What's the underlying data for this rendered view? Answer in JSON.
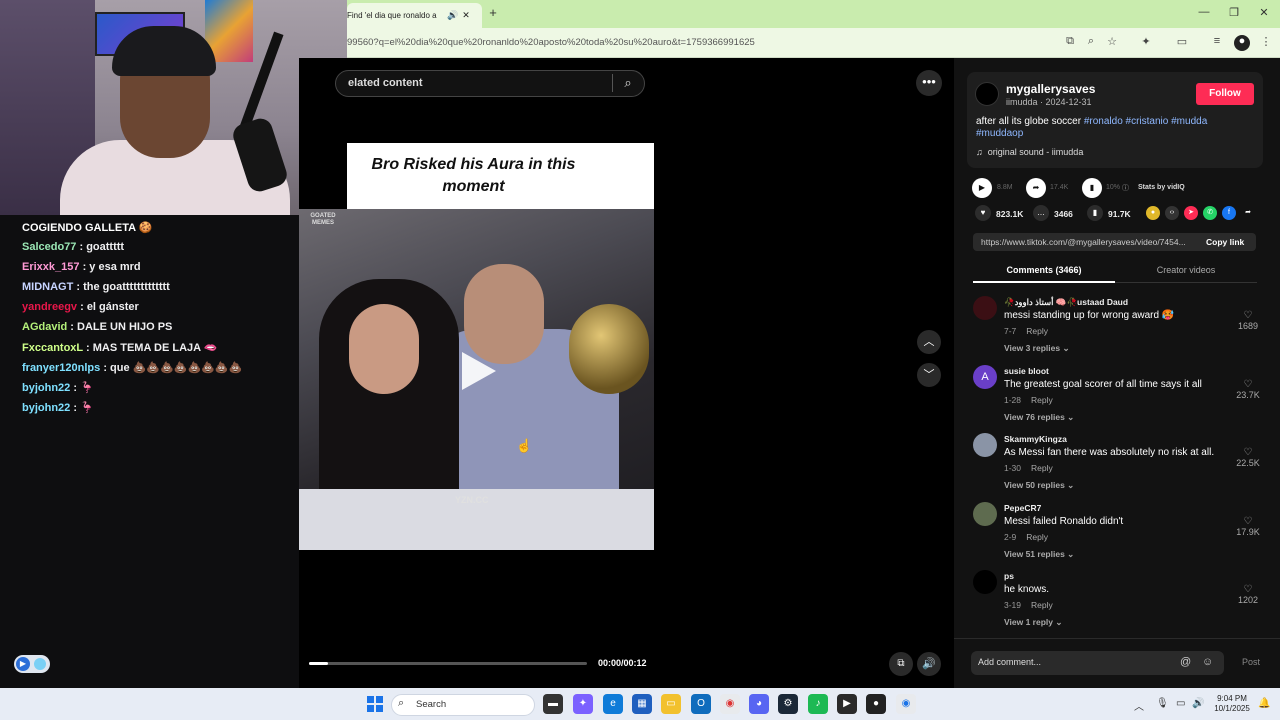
{
  "browser": {
    "tab_title": "Find 'el dia que ronaldo a",
    "url": "99560?q=el%20dia%20que%20ronanldo%20aposto%20toda%20su%20auro&t=1759366991625"
  },
  "chat": {
    "lines": [
      {
        "user": "COGIENDO GALLETA 🍪",
        "msg": "",
        "color": "#ffffff"
      },
      {
        "user": "Salcedo77",
        "msg": ": goattttt",
        "color": "#9ae6b4"
      },
      {
        "user": "Erixxk_157",
        "msg": ": y esa mrd",
        "color": "#ff9ad5"
      },
      {
        "user": "MIDNAGT",
        "msg": ": the goattttttttttttt",
        "color": "#c7d4ff"
      },
      {
        "user": "yandreegv",
        "msg": ": el gánster",
        "color": "#e8174a"
      },
      {
        "user": "AGdavid",
        "msg": ": DALE UN HIJO PS",
        "color": "#b4f07a"
      },
      {
        "user": "FxccantoxL",
        "msg": ": MAS TEMA DE LAJA 🫦",
        "color": "#cfff8a"
      },
      {
        "user": "franyer120nlps",
        "msg": ": que 💩💩💩💩💩💩💩💩",
        "color": "#7fe0ff"
      },
      {
        "user": "byjohn22",
        "msg": ": 🦩",
        "color": "#7fe0ff"
      },
      {
        "user": "byjohn22",
        "msg": ": 🦩",
        "color": "#7fe0ff"
      }
    ]
  },
  "video": {
    "search_label": "elated content",
    "caption": "Bro Risked his Aura in this moment",
    "goated_label": "GOATED MEMES",
    "watermark": "YZN.CC",
    "timecode": "00:00/00:12",
    "progress": 0.07
  },
  "post": {
    "username": "mygallerysaves",
    "subline": "iimudda · 2024-12-31",
    "follow_label": "Follow",
    "desc_text": "after all its globe soccer ",
    "hashtags": [
      "#ronaldo",
      "#cristanio",
      "#mudda",
      "#muddaop"
    ],
    "sound": "original sound - iimudda",
    "stats": {
      "plays": "8.8M",
      "shares": "17.4K",
      "rate": "10%",
      "vidiq_label": "Stats by vidIQ"
    },
    "likes": "823.1K",
    "comments_count": "3466",
    "saves": "91.7K",
    "link": "https://www.tiktok.com/@mygallerysaves/video/7454...",
    "copy_link_label": "Copy link",
    "tab_comments": "Comments (3466)",
    "tab_creator": "Creator videos"
  },
  "comments": [
    {
      "name": "🥀أستاذ داوود 🧠🥀ustaad Daud",
      "text": "messi standing up for wrong award 🥵",
      "date": "7-7",
      "reply": "Reply",
      "views": "View 3 replies",
      "likes": "1689",
      "avatar_color": "#3b0f14"
    },
    {
      "name": "susie bloot",
      "text": "The greatest goal scorer of all time says it all",
      "date": "1-28",
      "reply": "Reply",
      "views": "View 76 replies",
      "likes": "23.7K",
      "avatar_color": "#6a3fc8",
      "avatar_letter": "A"
    },
    {
      "name": "SkammyKingza",
      "text": "As Messi fan there was absolutely no risk at all.",
      "date": "1-30",
      "reply": "Reply",
      "views": "View 50 replies",
      "likes": "22.5K",
      "avatar_color": "#8a94a6"
    },
    {
      "name": "PepeCR7",
      "text": "Messi failed Ronaldo didn't",
      "date": "2-9",
      "reply": "Reply",
      "views": "View 51 replies",
      "likes": "17.9K",
      "avatar_color": "#5e6b4f"
    },
    {
      "name": "ps",
      "text": "he knows.",
      "date": "3-19",
      "reply": "Reply",
      "views": "View 1 reply",
      "likes": "1202",
      "avatar_color": "#000000"
    }
  ],
  "composer": {
    "placeholder": "Add comment...",
    "post_label": "Post"
  },
  "taskbar": {
    "search_label": "Search",
    "time": "9:04 PM",
    "date": "10/1/2025"
  }
}
